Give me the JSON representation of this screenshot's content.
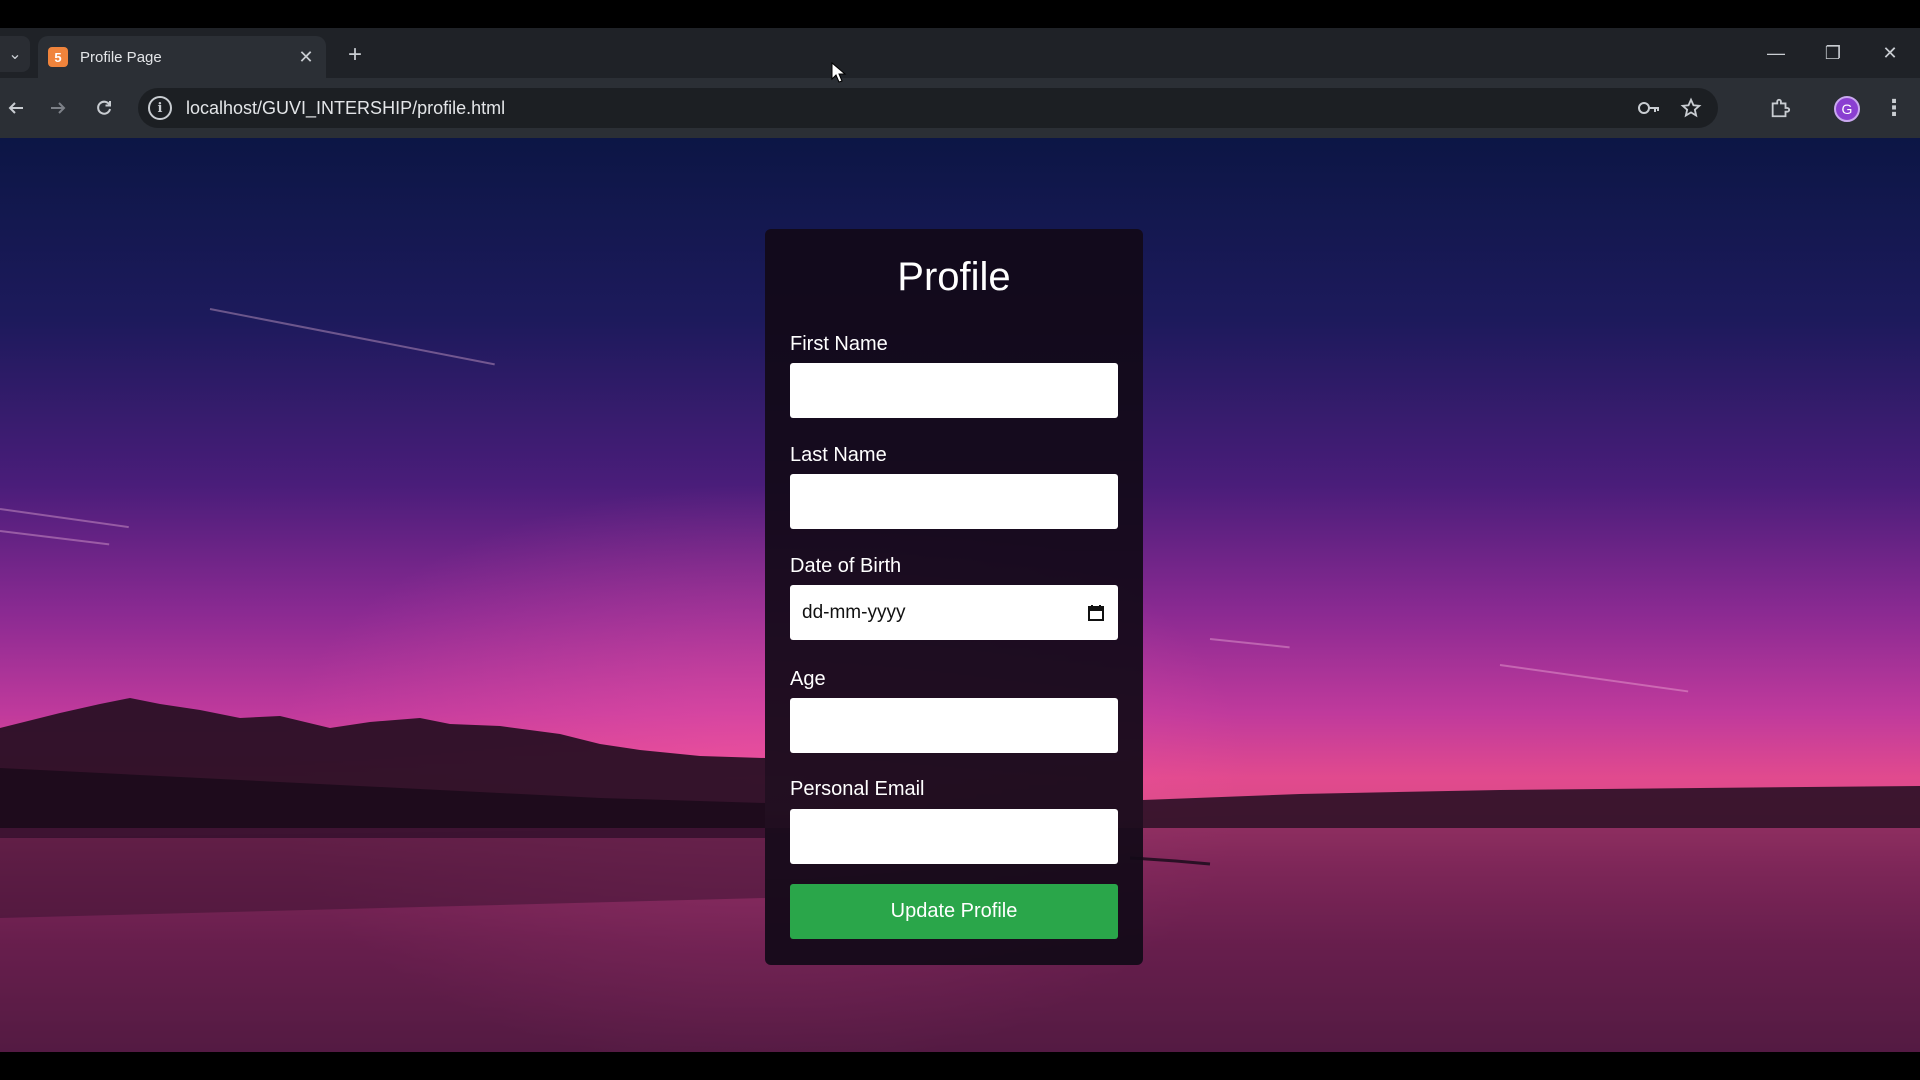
{
  "browser": {
    "tab": {
      "title": "Profile Page",
      "favicon": "html5-icon",
      "close_label": "✕"
    },
    "new_tab_label": "+",
    "address": {
      "url": "localhost/GUVI_INTERSHIP/profile.html"
    },
    "window_controls": {
      "minimize": "—",
      "restore": "❐",
      "close": "✕"
    },
    "profile_initial": "G",
    "colors": {
      "chrome_dark": "#1f2227",
      "toolbar": "#2b2f35",
      "avatar": "#8a3fd1"
    }
  },
  "page": {
    "title": "Profile",
    "fields": [
      {
        "label": "First Name",
        "value": ""
      },
      {
        "label": "Last Name",
        "value": ""
      },
      {
        "label": "Date of Birth",
        "placeholder": "dd-mm-yyyy"
      },
      {
        "label": "Age",
        "value": ""
      },
      {
        "label": "Personal Email",
        "value": ""
      }
    ],
    "submit_label": "Update Profile",
    "colors": {
      "card": "#120a18",
      "button": "#2aa64a"
    }
  }
}
